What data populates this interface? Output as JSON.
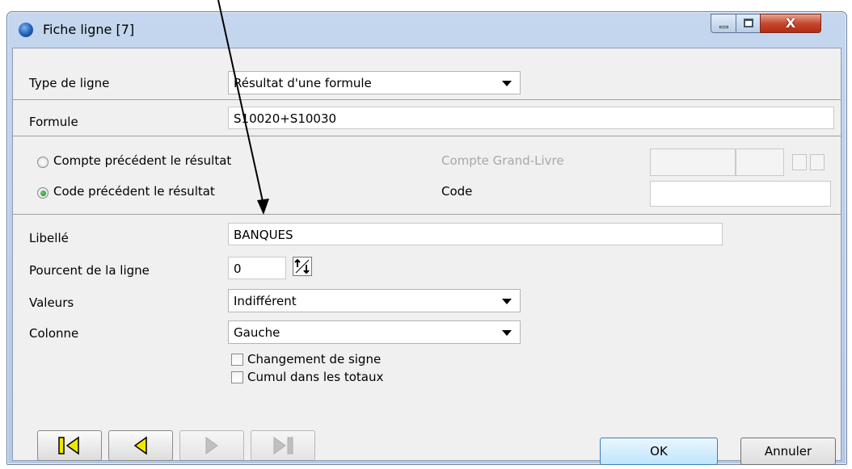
{
  "window": {
    "title": "Fiche ligne [7]",
    "close_glyph": "X"
  },
  "form": {
    "type_label": "Type de ligne",
    "type_value": "Résultat d'une formule",
    "formule_label": "Formule",
    "formule_value": "S10020+S10030",
    "radio_compte_label": "Compte précédent le résultat",
    "radio_code_label": "Code précédent le résultat",
    "compte_gl_label": "Compte Grand-Livre",
    "code_label": "Code",
    "code_value": "",
    "libelle_label": "Libellé",
    "libelle_value": "BANQUES",
    "pourcent_label": "Pourcent de la ligne",
    "pourcent_value": "0",
    "valeurs_label": "Valeurs",
    "valeurs_value": "Indifférent",
    "colonne_label": "Colonne",
    "colonne_value": "Gauche",
    "chk_signe_label": "Changement de signe",
    "chk_cumul_label": "Cumul dans les totaux"
  },
  "buttons": {
    "ok": "OK",
    "cancel": "Annuler"
  },
  "icons": [
    "app-icon",
    "first-record-icon",
    "previous-record-icon",
    "next-record-icon",
    "last-record-icon",
    "spin-icon"
  ],
  "colors": {
    "nav_accent": "#f0e800",
    "radio_on": "#1c7a1c",
    "titlebar": "#c4d7ee"
  }
}
